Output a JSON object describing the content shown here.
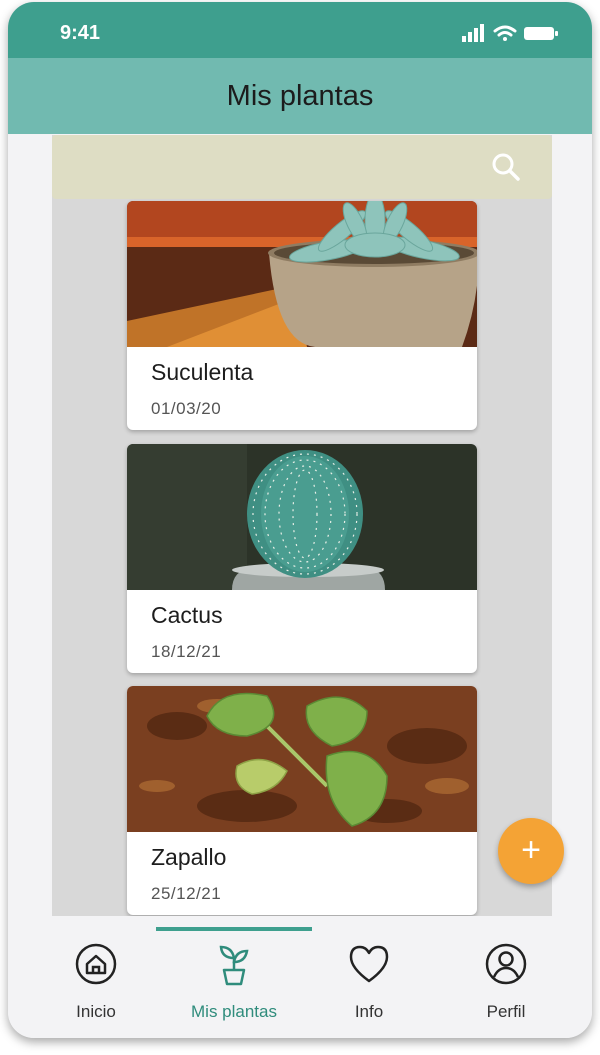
{
  "status_bar": {
    "time": "9:41"
  },
  "app_bar": {
    "title": "Mis plantas"
  },
  "search": {
    "icon": "search-icon"
  },
  "plants": [
    {
      "name": "Suculenta",
      "date": "01/03/20",
      "image": "succulent-photo"
    },
    {
      "name": "Cactus",
      "date": "18/12/21",
      "image": "cactus-photo"
    },
    {
      "name": "Zapallo",
      "date": "25/12/21",
      "image": "pumpkin-seedling-photo"
    }
  ],
  "fab": {
    "label": "+"
  },
  "nav": {
    "items": [
      {
        "label": "Inicio",
        "icon": "home-icon"
      },
      {
        "label": "Mis plantas",
        "icon": "plant-pot-icon",
        "active": true
      },
      {
        "label": "Info",
        "icon": "heart-icon"
      },
      {
        "label": "Perfil",
        "icon": "profile-icon"
      }
    ]
  },
  "colors": {
    "status_bar": "#3e9f8e",
    "app_bar": "#71bab0",
    "search_bg": "#deddc4",
    "fab": "#f4a335",
    "active": "#2f8c7c"
  }
}
